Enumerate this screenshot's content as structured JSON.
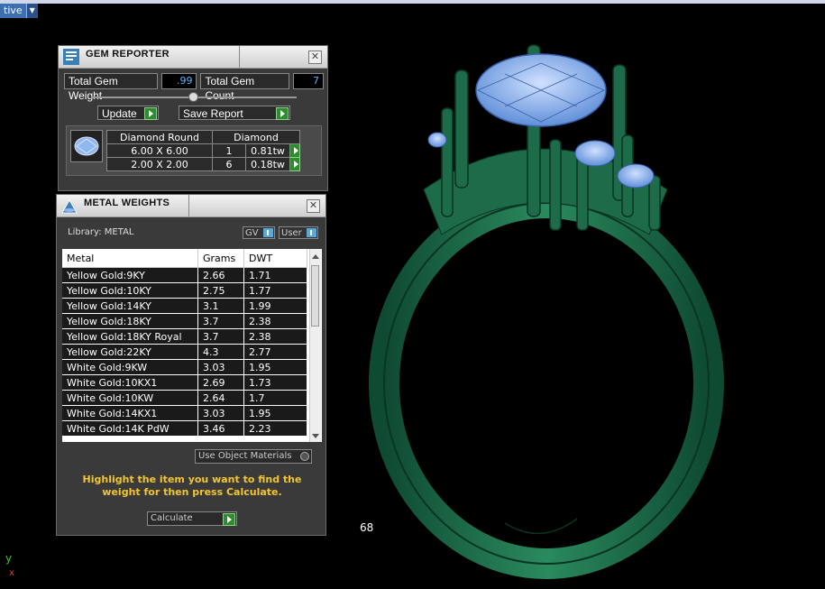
{
  "top_bar": {
    "mode_label": "tive"
  },
  "viewport": {
    "number_label": "68",
    "axis_y": "y",
    "axis_x": "x",
    "ring_color": "#1e6b49",
    "gem_color": "#8fb8f0"
  },
  "gem_reporter": {
    "title": "GEM REPORTER",
    "total_weight_label": "Total Gem Weight",
    "total_weight_value": ".99",
    "total_count_label": "Total Gem Count",
    "total_count_value": "7",
    "update_label": "Update",
    "save_report_label": "Save Report",
    "table_header": {
      "shape": "Diamond Round",
      "material": "Diamond"
    },
    "rows": [
      {
        "size": "6.00 X 6.00",
        "count": "1",
        "weight": "0.81tw"
      },
      {
        "size": "2.00 X 2.00",
        "count": "6",
        "weight": "0.18tw"
      }
    ]
  },
  "metal_weights": {
    "title": "METAL WEIGHTS",
    "library_label": "Library: METAL",
    "toggle_gv": "GV",
    "toggle_user": "User",
    "columns": [
      "Metal",
      "Grams",
      "DWT"
    ],
    "rows": [
      [
        "Yellow Gold:9KY",
        "2.66",
        "1.71"
      ],
      [
        "Yellow Gold:10KY",
        "2.75",
        "1.77"
      ],
      [
        "Yellow Gold:14KY",
        "3.1",
        "1.99"
      ],
      [
        "Yellow Gold:18KY",
        "3.7",
        "2.38"
      ],
      [
        "Yellow Gold:18KY Royal",
        "3.7",
        "2.38"
      ],
      [
        "Yellow Gold:22KY",
        "4.3",
        "2.77"
      ],
      [
        "White Gold:9KW",
        "3.03",
        "1.95"
      ],
      [
        "White Gold:10KX1",
        "2.69",
        "1.73"
      ],
      [
        "White Gold:10KW",
        "2.64",
        "1.7"
      ],
      [
        "White Gold:14KX1",
        "3.03",
        "1.95"
      ],
      [
        "White Gold:14K PdW",
        "3.46",
        "2.23"
      ]
    ],
    "use_object_materials_label": "Use Object Materials",
    "instruction": "Highlight the item you want to find the weight for then press Calculate.",
    "calculate_label": "Calculate"
  }
}
